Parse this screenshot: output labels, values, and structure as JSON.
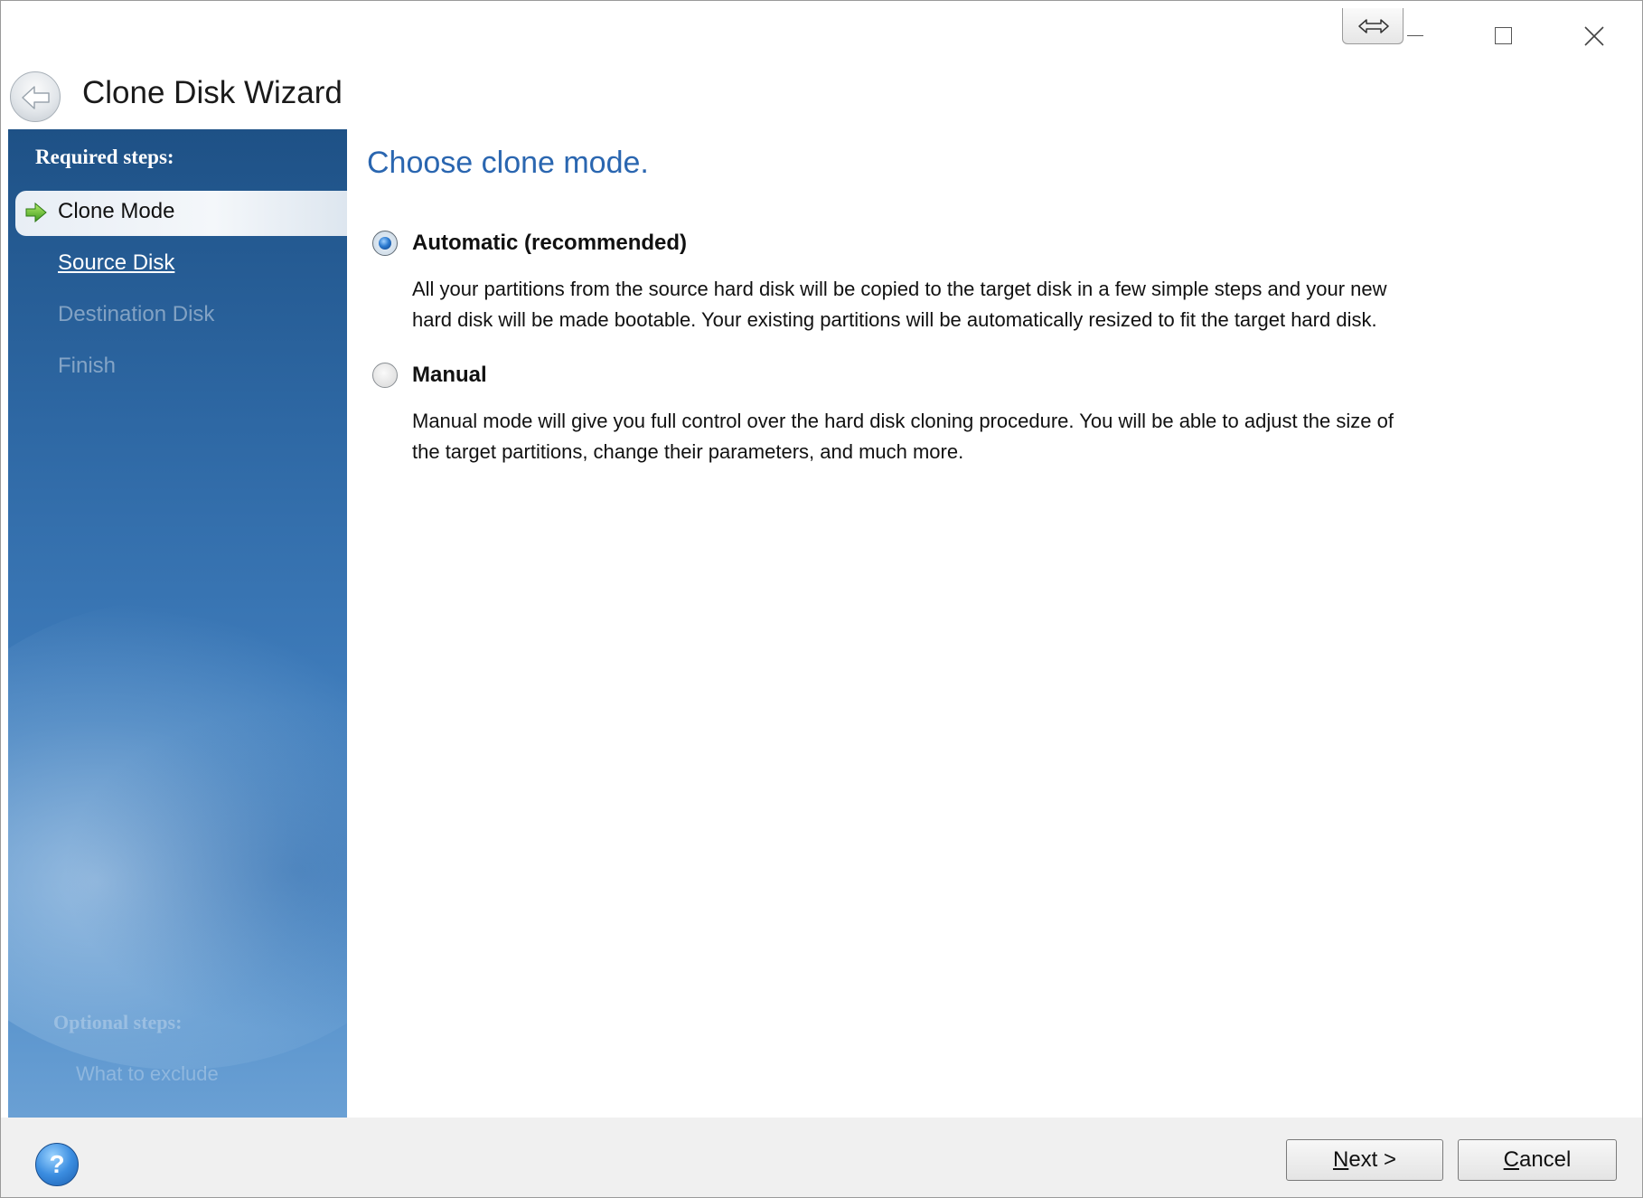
{
  "window": {
    "title": "Clone Disk Wizard"
  },
  "sidebar": {
    "required_heading": "Required steps:",
    "steps": [
      {
        "label": "Clone Mode",
        "state": "current"
      },
      {
        "label": "Source Disk",
        "state": "link"
      },
      {
        "label": "Destination Disk",
        "state": "disabled"
      },
      {
        "label": "Finish",
        "state": "disabled"
      }
    ],
    "optional_heading": "Optional steps:",
    "optional_steps": [
      {
        "label": "What to exclude",
        "state": "disabled"
      }
    ]
  },
  "main": {
    "title": "Choose clone mode.",
    "options": [
      {
        "label": "Automatic (recommended)",
        "selected": true,
        "description_lines": [
          "All your partitions from the source hard disk will be copied to the target disk in a few simple steps and your new",
          "hard disk will be made bootable. Your existing partitions will be automatically resized to fit the target hard disk."
        ]
      },
      {
        "label": "Manual",
        "selected": false,
        "description_lines": [
          "Manual mode will give you full control over the hard disk cloning procedure. You will be able to adjust the size of",
          "the target partitions, change their parameters, and much more."
        ]
      }
    ]
  },
  "footer": {
    "help_glyph": "?",
    "next_button": {
      "mnemonic": "N",
      "rest": "ext >"
    },
    "cancel_button": {
      "mnemonic": "C",
      "rest": "ancel"
    }
  },
  "colors": {
    "title_accent": "#2a66b0",
    "sidebar_top": "#1e5186",
    "sidebar_bottom": "#6aa0d4",
    "footer_bg": "#f0f0f0"
  }
}
